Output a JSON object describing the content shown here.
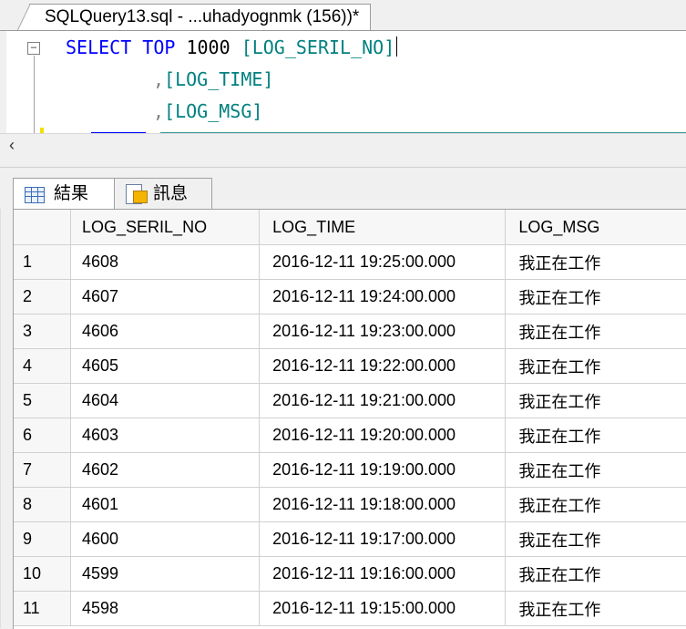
{
  "document_tab": {
    "title": "SQLQuery13.sql - ...uhadyognmk (156))*"
  },
  "editor": {
    "line1": {
      "keyword1": "SELECT",
      "keyword2": "TOP",
      "number": "1000",
      "column": "[LOG_SERIL_NO]"
    },
    "line2": {
      "comma": ",",
      "column": "[LOG_TIME]"
    },
    "line3": {
      "comma": ",",
      "column": "[LOG_MSG]"
    }
  },
  "results_tabs": [
    {
      "label": "結果",
      "icon": "grid-icon",
      "active": true
    },
    {
      "label": "訊息",
      "icon": "message-icon",
      "active": false
    }
  ],
  "results": {
    "columns": [
      "LOG_SERIL_NO",
      "LOG_TIME",
      "LOG_MSG"
    ],
    "rows": [
      {
        "num": "1",
        "serial": "4608",
        "time": "2016-12-11 19:25:00.000",
        "msg": "我正在工作"
      },
      {
        "num": "2",
        "serial": "4607",
        "time": "2016-12-11 19:24:00.000",
        "msg": "我正在工作"
      },
      {
        "num": "3",
        "serial": "4606",
        "time": "2016-12-11 19:23:00.000",
        "msg": "我正在工作"
      },
      {
        "num": "4",
        "serial": "4605",
        "time": "2016-12-11 19:22:00.000",
        "msg": "我正在工作"
      },
      {
        "num": "5",
        "serial": "4604",
        "time": "2016-12-11 19:21:00.000",
        "msg": "我正在工作"
      },
      {
        "num": "6",
        "serial": "4603",
        "time": "2016-12-11 19:20:00.000",
        "msg": "我正在工作"
      },
      {
        "num": "7",
        "serial": "4602",
        "time": "2016-12-11 19:19:00.000",
        "msg": "我正在工作"
      },
      {
        "num": "8",
        "serial": "4601",
        "time": "2016-12-11 19:18:00.000",
        "msg": "我正在工作"
      },
      {
        "num": "9",
        "serial": "4600",
        "time": "2016-12-11 19:17:00.000",
        "msg": "我正在工作"
      },
      {
        "num": "10",
        "serial": "4599",
        "time": "2016-12-11 19:16:00.000",
        "msg": "我正在工作"
      },
      {
        "num": "11",
        "serial": "4598",
        "time": "2016-12-11 19:15:00.000",
        "msg": "我正在工作"
      }
    ]
  },
  "colors": {
    "keyword": "#0000ff",
    "identifier": "#008080",
    "operator": "#808080",
    "text": "#000000"
  }
}
